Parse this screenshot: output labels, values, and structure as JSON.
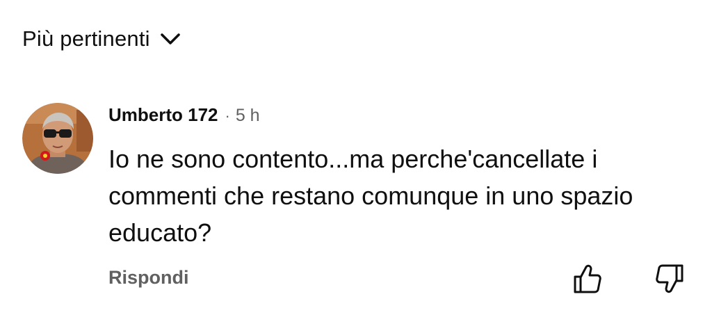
{
  "sort": {
    "label": "Più pertinenti",
    "icon": "chevron-down-icon"
  },
  "comment": {
    "author": "Umberto 172",
    "separator": "·",
    "time": "5 h",
    "text": "Io ne sono contento...ma perche'cancellate i commenti che restano comunque in uno spazio educato?",
    "avatar_icon": "user-avatar"
  },
  "actions": {
    "reply_label": "Rispondi",
    "like_icon": "thumbs-up-icon",
    "dislike_icon": "thumbs-down-icon"
  },
  "colors": {
    "text_primary": "#0f0f0f",
    "text_secondary": "#606060",
    "background": "#ffffff"
  }
}
